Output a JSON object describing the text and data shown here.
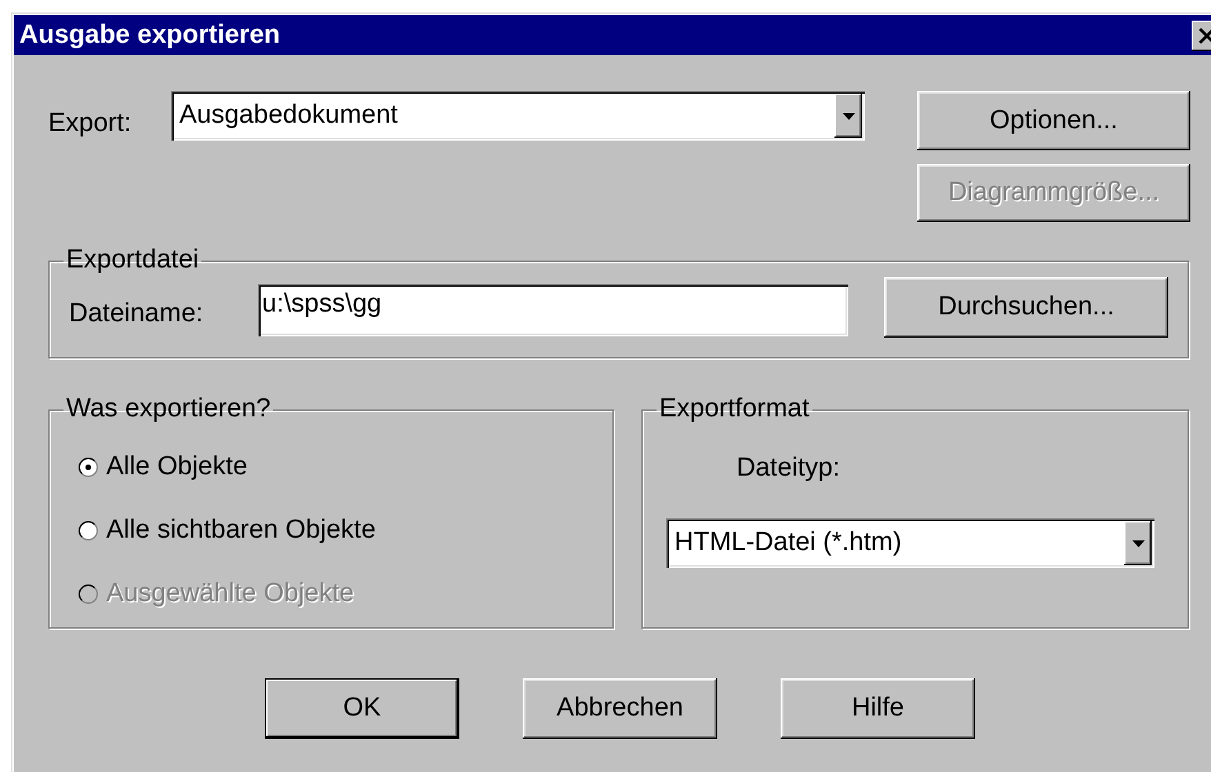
{
  "window": {
    "title": "Ausgabe exportieren"
  },
  "export": {
    "label": "Export:",
    "value": "Ausgabedokument"
  },
  "side_buttons": [
    {
      "label": "Optionen...",
      "disabled": false
    },
    {
      "label": "Diagrammgröße...",
      "disabled": true
    }
  ],
  "export_file": {
    "title": "Exportdatei",
    "label": "Dateiname:",
    "value": "u:\\spss\\gg",
    "button": "Durchsuchen..."
  },
  "what": {
    "title": "Was exportieren?",
    "options": [
      {
        "label": "Alle Objekte",
        "selected": true,
        "disabled": false
      },
      {
        "label": "Alle sichtbaren Objekte",
        "selected": false,
        "disabled": false
      },
      {
        "label": "Ausgewählte Objekte",
        "selected": false,
        "disabled": true
      }
    ]
  },
  "format": {
    "title": "Exportformat",
    "label": "Dateityp:",
    "value": "HTML-Datei (*.htm)"
  },
  "buttons": [
    {
      "label": "OK",
      "default": true
    },
    {
      "label": "Abbrechen",
      "default": false
    },
    {
      "label": "Hilfe",
      "default": false
    }
  ]
}
